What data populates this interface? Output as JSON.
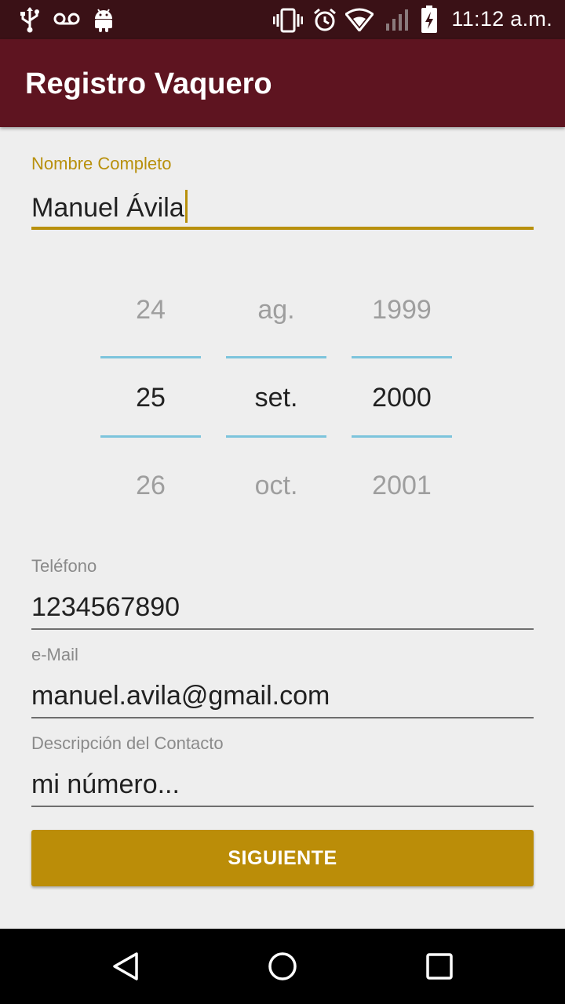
{
  "status_bar": {
    "time": "11:12 a.m.",
    "left_icons": [
      "usb-icon",
      "voicemail-icon",
      "android-icon"
    ],
    "right_icons": [
      "vibrate-icon",
      "alarm-icon",
      "wifi-icon",
      "signal-icon",
      "battery-charging-icon"
    ]
  },
  "app_bar": {
    "title": "Registro Vaquero"
  },
  "form": {
    "name": {
      "label": "Nombre Completo",
      "value": "Manuel Ávila"
    },
    "date_picker": {
      "day": {
        "prev": "24",
        "selected": "25",
        "next": "26"
      },
      "month": {
        "prev": "ag.",
        "selected": "set.",
        "next": "oct."
      },
      "year": {
        "prev": "1999",
        "selected": "2000",
        "next": "2001"
      }
    },
    "phone": {
      "label": "Teléfono",
      "value": "1234567890"
    },
    "email": {
      "label": "e-Mail",
      "value": "manuel.avila@gmail.com"
    },
    "description": {
      "label": "Descripción del Contacto",
      "value": "mi número..."
    },
    "next_button": {
      "label": "SIGUIENTE"
    }
  },
  "colors": {
    "status_bar": "#3a1116",
    "app_bar": "#5e1420",
    "accent": "#b8900c",
    "button": "#bb8d08",
    "picker_divider": "#7cc4dc"
  },
  "nav_bar": {
    "icons": [
      "back-icon",
      "home-icon",
      "recents-icon"
    ]
  }
}
